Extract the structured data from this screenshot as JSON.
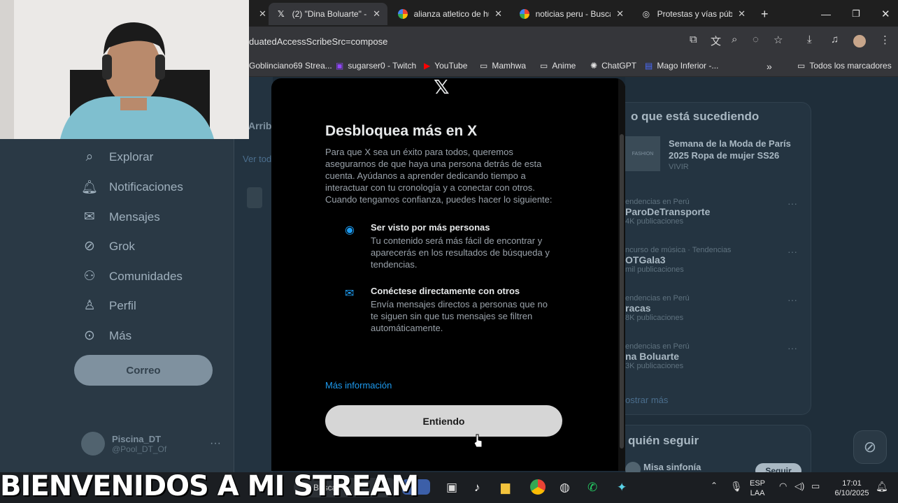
{
  "browser": {
    "tabs": [
      {
        "title": "(2) \"Dina Boluarte\" - X",
        "favicon": "X",
        "active": true
      },
      {
        "title": "alianza atletico de hu",
        "favicon": "google"
      },
      {
        "title": "noticias peru - Buscar",
        "favicon": "google"
      },
      {
        "title": "Protestas y vías públi",
        "favicon": "globe"
      }
    ],
    "new_tab": "+",
    "url": "duatedAccessScribeSrc=compose",
    "bookmarks": [
      {
        "label": "Goblinciano69 Strea..."
      },
      {
        "label": "sugarser0 - Twitch"
      },
      {
        "label": "YouTube"
      },
      {
        "label": "Mamhwa"
      },
      {
        "label": "Anime"
      },
      {
        "label": "ChatGPT"
      },
      {
        "label": "Mago Inferior -..."
      }
    ],
    "all_bookmarks": "Todos los marcadores",
    "overflow": "»"
  },
  "sidebar": {
    "items": [
      {
        "label": "Explorar",
        "icon": "search-icon"
      },
      {
        "label": "Notificaciones",
        "icon": "bell-icon"
      },
      {
        "label": "Mensajes",
        "icon": "mail-icon"
      },
      {
        "label": "Grok",
        "icon": "grok-icon"
      },
      {
        "label": "Comunidades",
        "icon": "people-icon"
      },
      {
        "label": "Perfil",
        "icon": "person-icon"
      },
      {
        "label": "Más",
        "icon": "more-circle-icon"
      }
    ],
    "post_button": "Correo",
    "profile": {
      "name": "Piscina_DT",
      "handle": "@Pool_DT_Of",
      "more": "···"
    }
  },
  "middle": {
    "tab_fragment": "Arriba",
    "see_all": "Ver tod"
  },
  "right": {
    "heading": "o que está sucediendo",
    "featured": {
      "title": "Semana de la Moda de París 2025 Ropa de mujer SS26",
      "category": "VIVIR",
      "thumb_label": "FASHION"
    },
    "trends": [
      {
        "category": "endencias en Perú",
        "name": "ParoDeTransporte",
        "count": "4K publicaciones"
      },
      {
        "category": "ncurso de música · Tendencias",
        "name": "OTGala3",
        "count": "mil publicaciones"
      },
      {
        "category": "endencias en Perú",
        "name": "racas",
        "count": "8K publicaciones"
      },
      {
        "category": "endencias en Perú",
        "name": "na Boluarte",
        "count": "3K publicaciones"
      }
    ],
    "show_more": "ostrar más",
    "who_to_follow": "quién seguir",
    "suggestion": {
      "name": "Misa sinfonía",
      "button": "Seguir"
    }
  },
  "modal": {
    "title": "Desbloquea más en X",
    "body": "Para que X sea un éxito para todos, queremos asegurarnos de que haya una persona detrás de esta cuenta. Ayúdanos a aprender dedicando tiempo a interactuar con tu cronología y a conectar con otros. Cuando tengamos confianza, puedes hacer lo siguiente:",
    "features": [
      {
        "title": "Ser visto por más personas",
        "desc": "Tu contenido será más fácil de encontrar y aparecerás en los resultados de búsqueda y tendencias.",
        "icon": "person-search-icon"
      },
      {
        "title": "Conéctese directamente con otros",
        "desc": "Envía mensajes directos a personas que no te siguen sin que tus mensajes se filtren automáticamente.",
        "icon": "message-plus-icon"
      }
    ],
    "more_info": "Más información",
    "confirm_button": "Entiendo"
  },
  "stream_overlay": "BIENVENIDOS A MI STREAM",
  "taskbar": {
    "search_placeholder": "Buscar",
    "lang": "ESP",
    "lang2": "LAA",
    "time": "17:01",
    "date": "6/10/2025"
  }
}
